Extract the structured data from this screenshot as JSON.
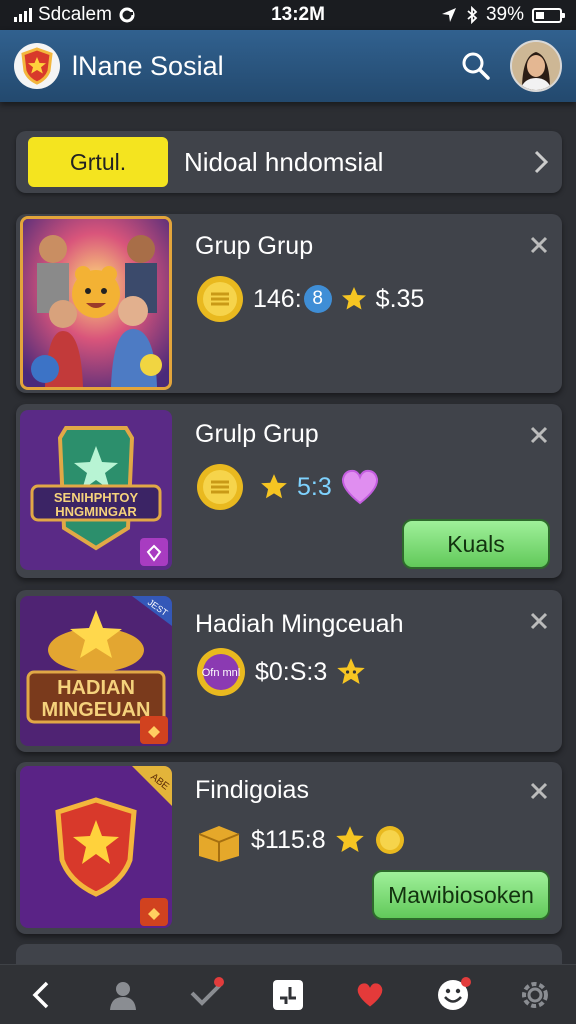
{
  "status": {
    "carrier": "Sdcalem",
    "time": "13:2M",
    "battery": "39%"
  },
  "appbar": {
    "title": "lNane Sosial"
  },
  "banner": {
    "pill": "Grtul.",
    "text": "Nidoal hndomsial"
  },
  "cards": [
    {
      "title": "Grup Grup",
      "value": "146:",
      "badge": "8",
      "price": "$.35"
    },
    {
      "title": "Grulp Grup",
      "value": "5:3",
      "button": "Kuals",
      "art_line1": "SENIHPHTOY",
      "art_line2": "HNGMINGAR"
    },
    {
      "title": "Hadiah Mingceuah",
      "coin_text": "Ofn mnl",
      "value": "$0:S:3",
      "art_line1": "HADIAN",
      "art_line2": "MINGEUAN",
      "ribbon": "JEST"
    },
    {
      "title": "Findigoias",
      "value": "$115:8",
      "button": "Mawibiosoken",
      "ribbon": "ABE"
    }
  ],
  "colors": {
    "accent_yellow": "#f4e41f",
    "cta_green": "#62c95a",
    "appbar_blue": "#2e5b88"
  },
  "icons": [
    "search-icon",
    "close-icon",
    "chevron-right-icon",
    "back-icon",
    "person-icon",
    "check-icon",
    "chat-icon",
    "heart-icon",
    "smile-icon",
    "gear-icon"
  ]
}
